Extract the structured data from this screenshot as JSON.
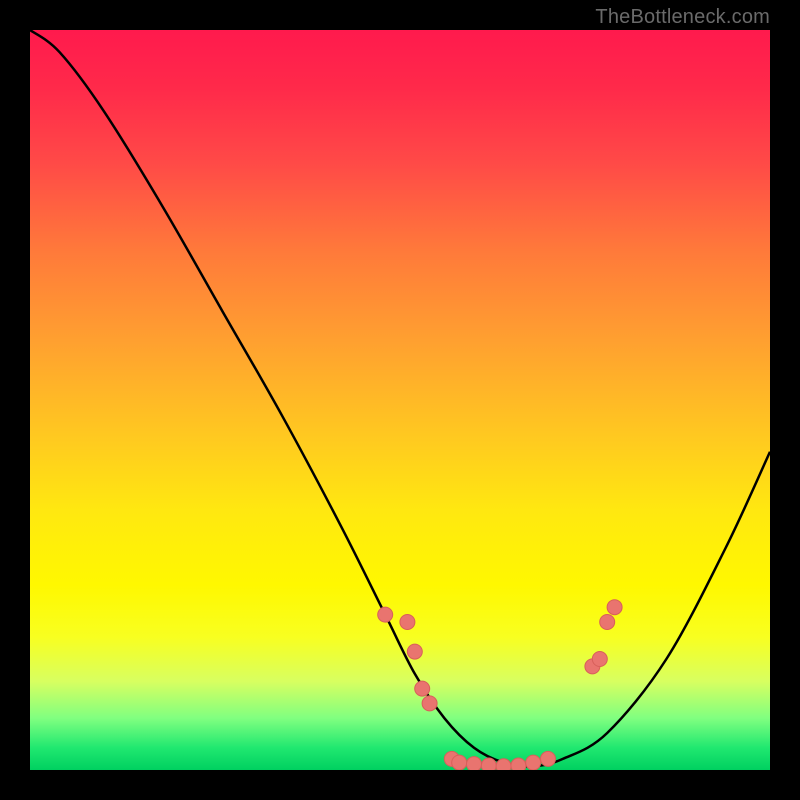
{
  "watermark": "TheBottleneck.com",
  "chart_data": {
    "type": "line",
    "title": "",
    "xlabel": "",
    "ylabel": "",
    "xlim": [
      0,
      100
    ],
    "ylim": [
      0,
      100
    ],
    "series": [
      {
        "name": "curve",
        "x": [
          0,
          4,
          10,
          18,
          26,
          34,
          42,
          48,
          52,
          56,
          60,
          64,
          68,
          72,
          78,
          86,
          94,
          100
        ],
        "y": [
          100,
          97,
          89,
          76,
          62,
          48,
          33,
          21,
          13,
          7,
          3,
          1,
          0.5,
          1.5,
          5,
          15,
          30,
          43
        ]
      }
    ],
    "markers": [
      {
        "x": 48,
        "y": 21
      },
      {
        "x": 51,
        "y": 20
      },
      {
        "x": 52,
        "y": 16
      },
      {
        "x": 53,
        "y": 11
      },
      {
        "x": 54,
        "y": 9
      },
      {
        "x": 57,
        "y": 1.5
      },
      {
        "x": 58,
        "y": 1
      },
      {
        "x": 60,
        "y": 0.8
      },
      {
        "x": 62,
        "y": 0.6
      },
      {
        "x": 64,
        "y": 0.5
      },
      {
        "x": 66,
        "y": 0.6
      },
      {
        "x": 68,
        "y": 1
      },
      {
        "x": 70,
        "y": 1.5
      },
      {
        "x": 76,
        "y": 14
      },
      {
        "x": 77,
        "y": 15
      },
      {
        "x": 78,
        "y": 20
      },
      {
        "x": 79,
        "y": 22
      }
    ]
  }
}
